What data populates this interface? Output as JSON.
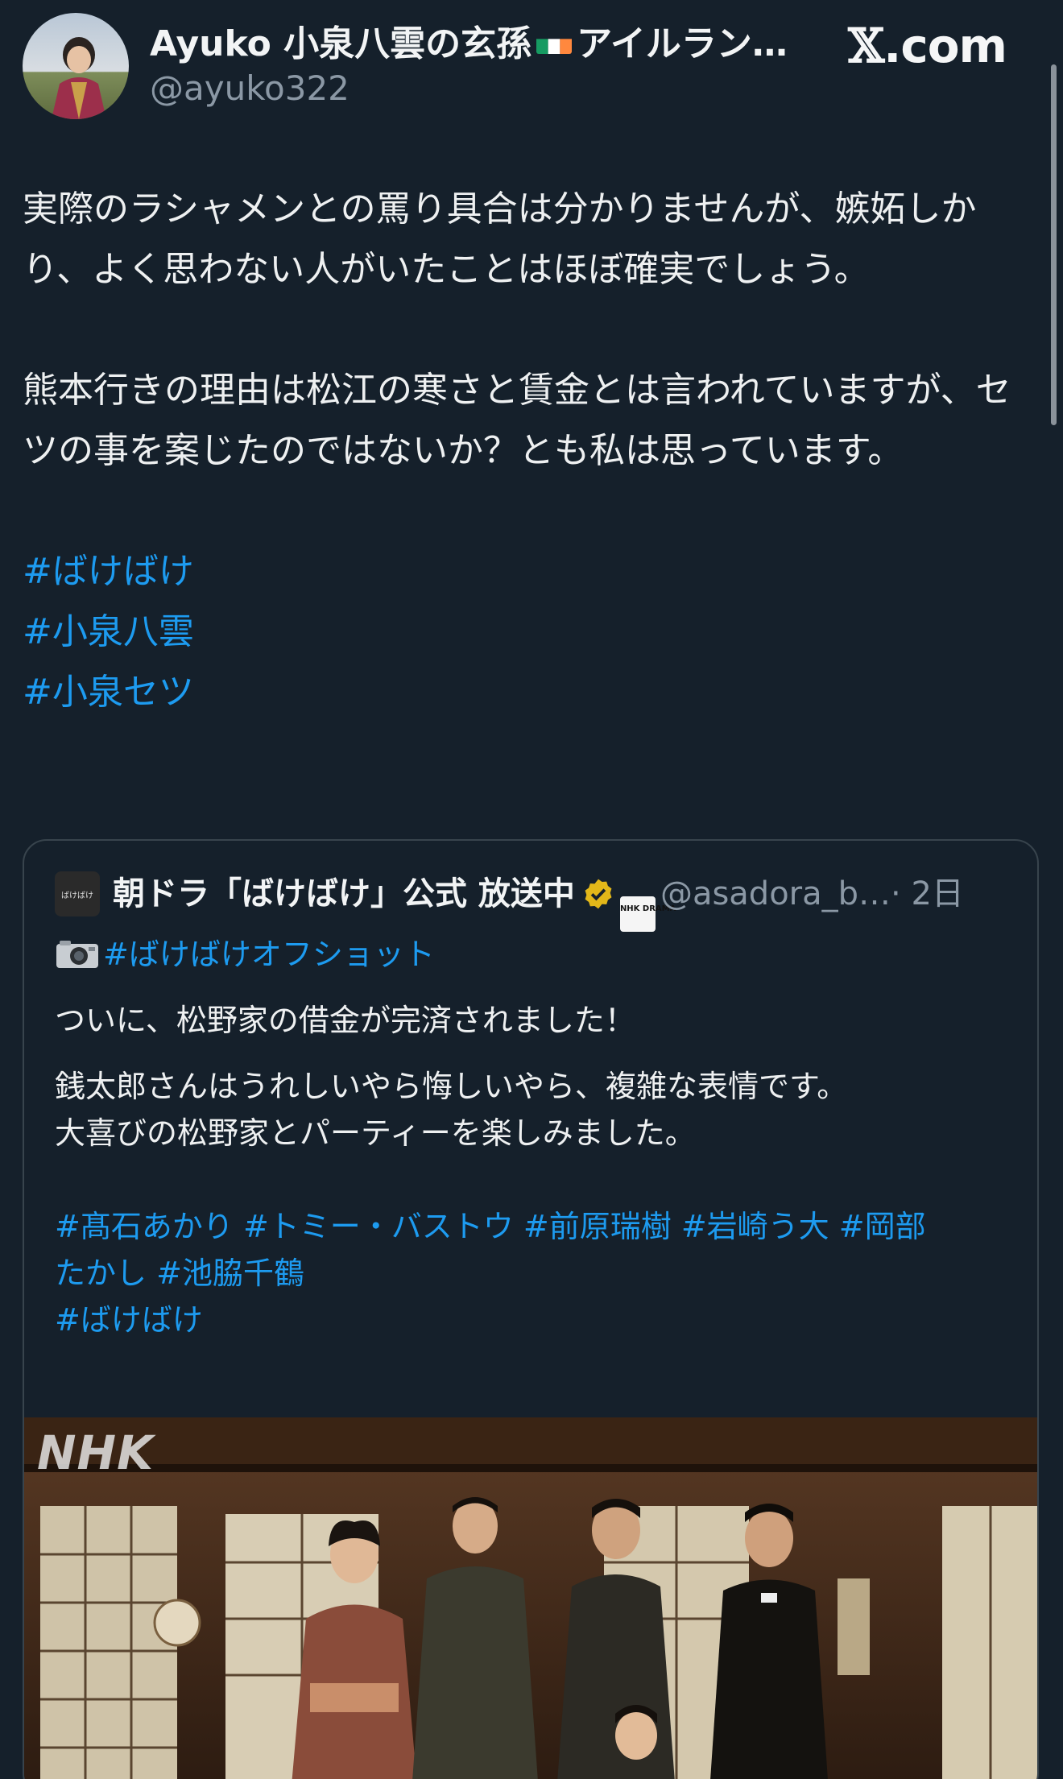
{
  "author": {
    "display_name_prefix": "Ayuko 小泉八雲の玄孫",
    "display_name_suffix": "アイルラン…",
    "flag_icon": "ireland-flag-icon",
    "handle": "@ayuko322"
  },
  "brand": {
    "x_symbol": "𝕏",
    "domain": ".com"
  },
  "tweet": {
    "para1": "実際のラシャメンとの罵り具合は分かりませんが、嫉妬しかり、よく思わない人がいたことはほぼ確実でしょう。",
    "para2": "熊本行きの理由は松江の寒さと賃金とは言われていますが、セツの事を案じたのではないか？とも私は思っています。",
    "hashtags": [
      "#ばけばけ",
      "#小泉八雲",
      "#小泉セツ"
    ]
  },
  "quoted": {
    "avatar_text": "ばけばけ",
    "name": "朝ドラ「ばけばけ」公式 放送中",
    "verified_icon": "verified-badge-icon",
    "org_badge": "NHK DRAMA",
    "handle": "@asadora_b…",
    "time": "· 2日",
    "camera_icon": "camera-icon",
    "offshot_tag": "#ばけばけオフショット",
    "line1": "ついに、松野家の借金が完済されました！",
    "line2": "銭太郎さんはうれしいやら悔しいやら、複雑な表情です。",
    "line3": "大喜びの松野家とパーティーを楽しみました。",
    "tags_line1": [
      "#髙石あかり",
      "#トミー・バストウ",
      "#前原瑞樹",
      "#岩崎う大",
      "#岡部"
    ],
    "tags_line2": [
      "たかし",
      "#池脇千鶴"
    ],
    "tags_line3": "#ばけばけ",
    "image_watermark": "NHK"
  }
}
